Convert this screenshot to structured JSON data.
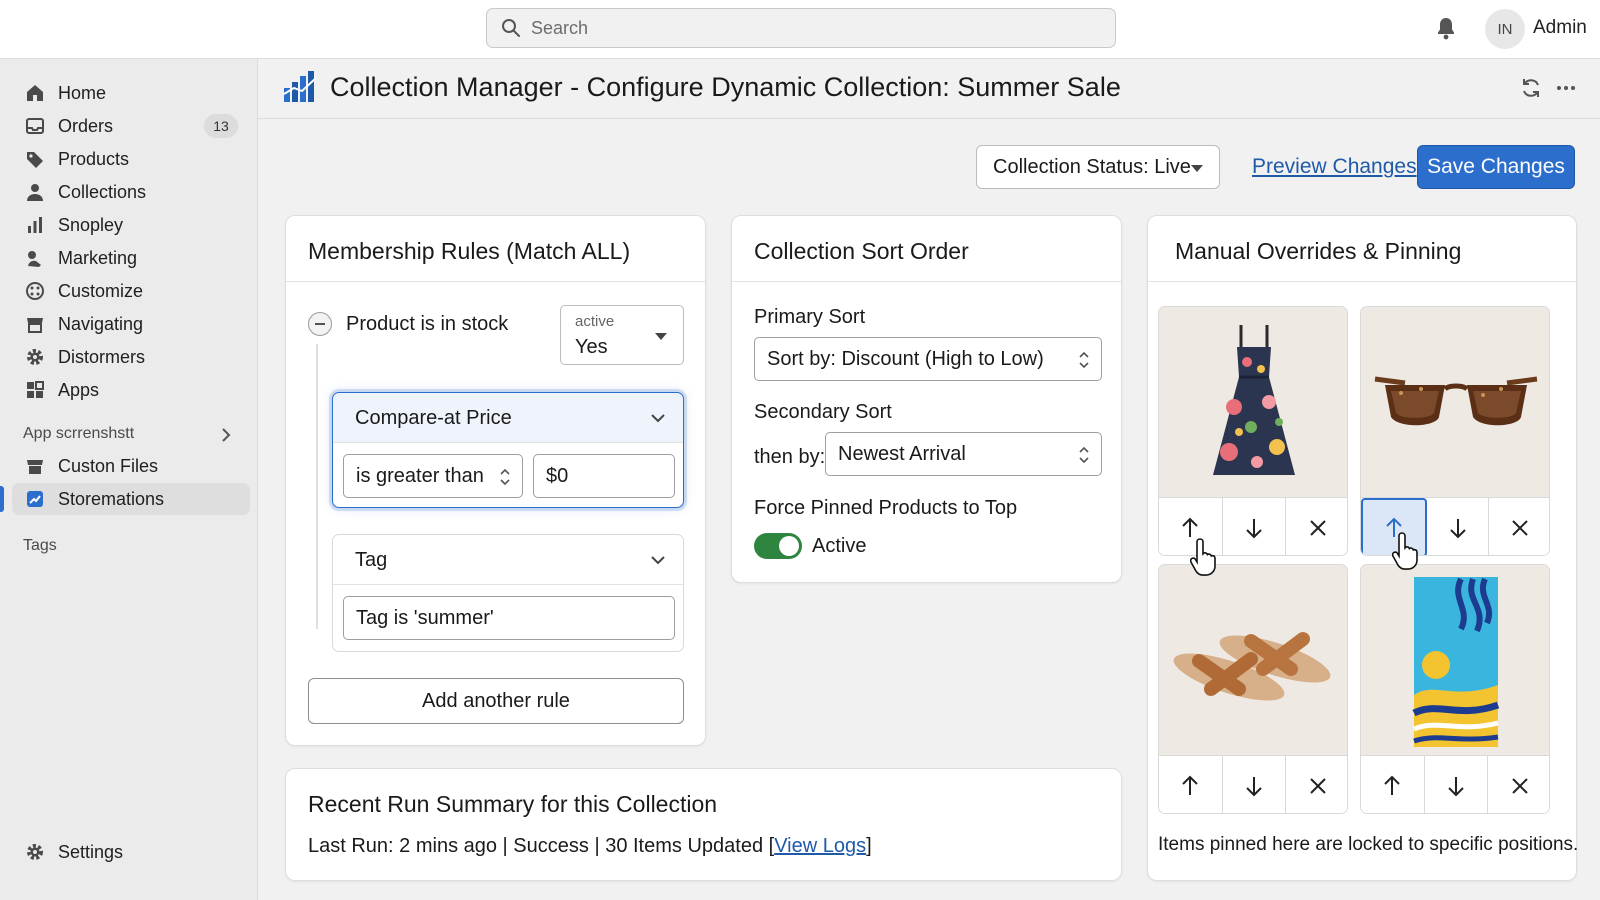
{
  "topbar": {
    "search_placeholder": "Search",
    "avatar_initials": "IN",
    "user_name": "Admin"
  },
  "sidebar": {
    "items": [
      {
        "label": "Home",
        "icon": "home-icon"
      },
      {
        "label": "Orders",
        "icon": "inbox-icon",
        "badge": "13"
      },
      {
        "label": "Products",
        "icon": "tag-icon"
      },
      {
        "label": "Collections",
        "icon": "person-icon"
      },
      {
        "label": "Snopley",
        "icon": "bar-chart-icon"
      },
      {
        "label": "Marketing",
        "icon": "megaphone-icon"
      },
      {
        "label": "Customize",
        "icon": "palette-icon"
      },
      {
        "label": "Navigating",
        "icon": "store-icon"
      },
      {
        "label": "Distormers",
        "icon": "gear-icon"
      },
      {
        "label": "Apps",
        "icon": "apps-icon"
      }
    ],
    "section_label": "App scrrenshstt",
    "app_items": [
      {
        "label": "Custon Files",
        "icon": "store-icon"
      },
      {
        "label": "Storemations",
        "icon": "flow-icon",
        "active": true
      }
    ],
    "tags_label": "Tags",
    "settings_label": "Settings"
  },
  "header": {
    "title": "Collection Manager - Configure Dynamic Collection: Summer Sale"
  },
  "actions": {
    "status_label": "Collection Status: Live",
    "preview_label": "Preview Changes",
    "save_label": "Save Changes"
  },
  "membership": {
    "title": "Membership Rules (Match ALL)",
    "stock_rule_label": "Product is in stock",
    "stock_select_label": "active",
    "stock_select_value": "Yes",
    "price_group_title": "Compare-at Price",
    "price_operator": "is greater than",
    "price_value": "$0",
    "tag_group_title": "Tag",
    "tag_value": "Tag is 'summer'",
    "add_rule_label": "Add another rule"
  },
  "sort": {
    "title": "Collection Sort Order",
    "primary_label": "Primary Sort",
    "primary_value": "Sort by: Discount (High to Low)",
    "secondary_label": "Secondary Sort",
    "then_by_label": "then by:",
    "secondary_value": "Newest Arrival",
    "force_pinned_label": "Force Pinned Products to Top",
    "toggle_state": "Active",
    "toggle_color": "#2e8540"
  },
  "overrides": {
    "title": "Manual Overrides & Pinning",
    "products": [
      {
        "name": "floral-dress-image"
      },
      {
        "name": "sunglasses-image"
      },
      {
        "name": "sandals-image"
      },
      {
        "name": "beach-towel-image"
      }
    ],
    "note": "Items pinned here are locked to specific positions."
  },
  "summary": {
    "title": "Recent Run Summary for this Collection",
    "text": "Last Run: 2 mins ago | Success | 30 Items Updated [",
    "link_label": "View Logs",
    "text_end": "]"
  },
  "colors": {
    "accent": "#2c6ecb",
    "link": "#1f5aa8"
  }
}
